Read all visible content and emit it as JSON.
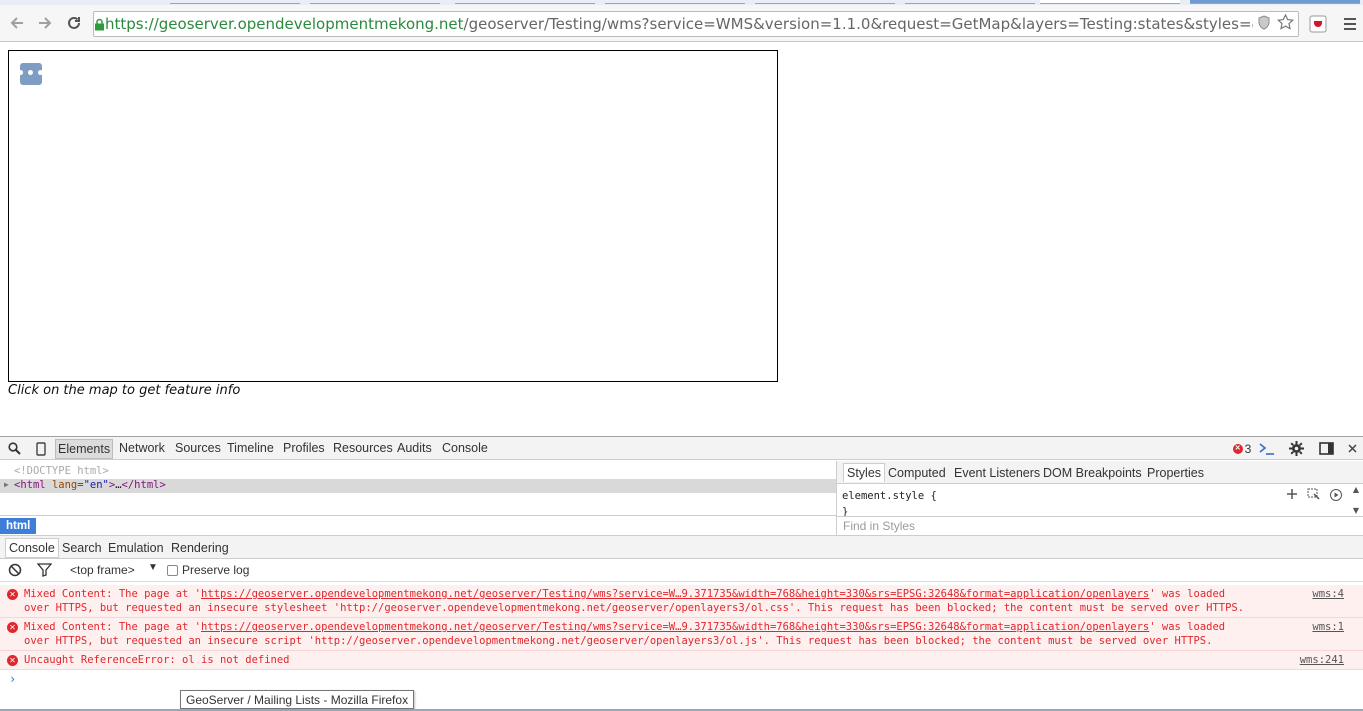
{
  "browser": {
    "url_host": "https://geoserver.opendevelopmentmekong.net",
    "url_path": "/geoserver/Testing/wms?service=WMS&version=1.1.0&request=GetMap&layers=Testing:states&styles=&bbox="
  },
  "page": {
    "map_button_label": "•••",
    "caption": "Click on the map to get feature info"
  },
  "devtools": {
    "tabs": [
      "Elements",
      "Network",
      "Sources",
      "Timeline",
      "Profiles",
      "Resources",
      "Audits",
      "Console"
    ],
    "error_count": "3",
    "elements": {
      "doctype": "<!DOCTYPE html>",
      "html_open_tag": "html",
      "html_attr_name": "lang",
      "html_attr_value": "\"en\"",
      "html_ellipsis": "…",
      "html_close_tag": "</html>"
    },
    "styles_tabs": [
      "Styles",
      "Computed",
      "Event Listeners",
      "DOM Breakpoints",
      "Properties"
    ],
    "element_style_open": "element.style {",
    "element_style_close": "}",
    "find_in_styles_placeholder": "Find in Styles",
    "breadcrumb": "html",
    "drawer_tabs": [
      "Console",
      "Search",
      "Emulation",
      "Rendering"
    ],
    "console_toolbar": {
      "frame_selector": "<top frame>",
      "preserve_log_label": "Preserve log"
    },
    "messages": [
      {
        "line1_prefix": "Mixed Content: The page at '",
        "line1_link": "https://geoserver.opendevelopmentmekong.net/geoserver/Testing/wms?service=W…9.371735&width=768&height=330&srs=EPSG:32648&format=application/openlayers",
        "line1_suffix": "' was loaded",
        "line2": "over HTTPS, but requested an insecure stylesheet 'http://geoserver.opendevelopmentmekong.net/geoserver/openlayers3/ol.css'. This request has been blocked; the content must be served over HTTPS.",
        "source": "wms:4"
      },
      {
        "line1_prefix": "Mixed Content: The page at '",
        "line1_link": "https://geoserver.opendevelopmentmekong.net/geoserver/Testing/wms?service=W…9.371735&width=768&height=330&srs=EPSG:32648&format=application/openlayers",
        "line1_suffix": "' was loaded",
        "line2": "over HTTPS, but requested an insecure script 'http://geoserver.opendevelopmentmekong.net/geoserver/openlayers3/ol.js'. This request has been blocked; the content must be served over HTTPS.",
        "source": "wms:1"
      },
      {
        "line1_prefix": "Uncaught ReferenceError: ol is not defined",
        "source": "wms:241"
      }
    ],
    "prompt_glyph": "›"
  },
  "tooltip": "GeoServer / Mailing Lists - Mozilla Firefox",
  "colors": {
    "url_host": "#2b8a3e",
    "error_red": "#e0272d",
    "breadcrumb_blue": "#3d7fd8",
    "map_button": "#6b8bbd"
  }
}
